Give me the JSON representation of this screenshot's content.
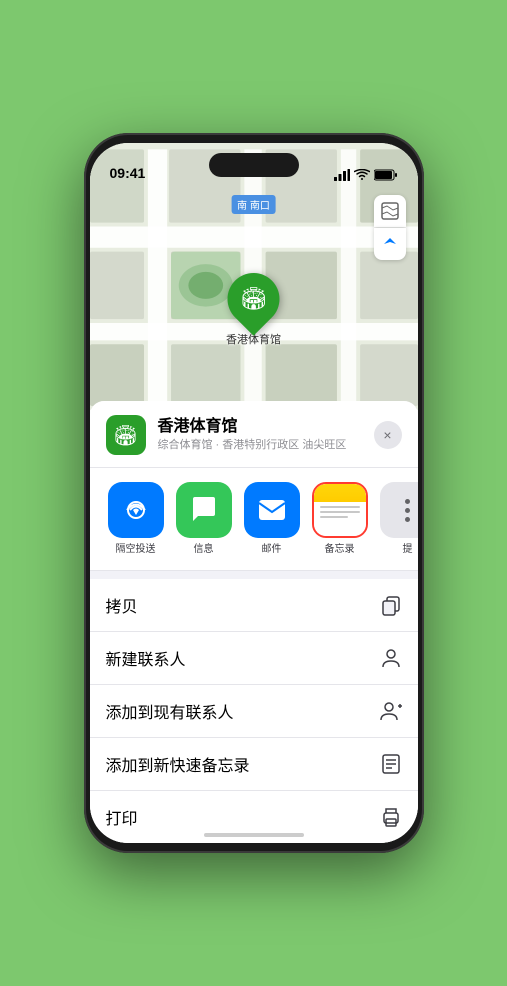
{
  "status_bar": {
    "time": "09:41",
    "signal_bars": "▌▌▌",
    "wifi": "WiFi",
    "battery": "Battery"
  },
  "map": {
    "label": "南口",
    "label_prefix": "南",
    "pin_label": "香港体育馆",
    "btn_map": "🗺",
    "btn_location": "➤"
  },
  "place_header": {
    "name": "香港体育馆",
    "subtitle": "综合体育馆 · 香港特别行政区 油尖旺区",
    "close_label": "×"
  },
  "share_row": {
    "items": [
      {
        "id": "airdrop",
        "label": "隔空投送",
        "type": "airdrop"
      },
      {
        "id": "message",
        "label": "信息",
        "type": "message"
      },
      {
        "id": "mail",
        "label": "邮件",
        "type": "mail"
      },
      {
        "id": "notes",
        "label": "备忘录",
        "type": "notes",
        "highlighted": true
      },
      {
        "id": "more",
        "label": "提",
        "type": "more"
      }
    ]
  },
  "actions": [
    {
      "id": "copy",
      "label": "拷贝",
      "icon": "copy"
    },
    {
      "id": "new-contact",
      "label": "新建联系人",
      "icon": "person"
    },
    {
      "id": "add-existing",
      "label": "添加到现有联系人",
      "icon": "person-add"
    },
    {
      "id": "quick-notes",
      "label": "添加到新快速备忘录",
      "icon": "memo"
    },
    {
      "id": "print",
      "label": "打印",
      "icon": "print"
    }
  ],
  "home_indicator": "—"
}
